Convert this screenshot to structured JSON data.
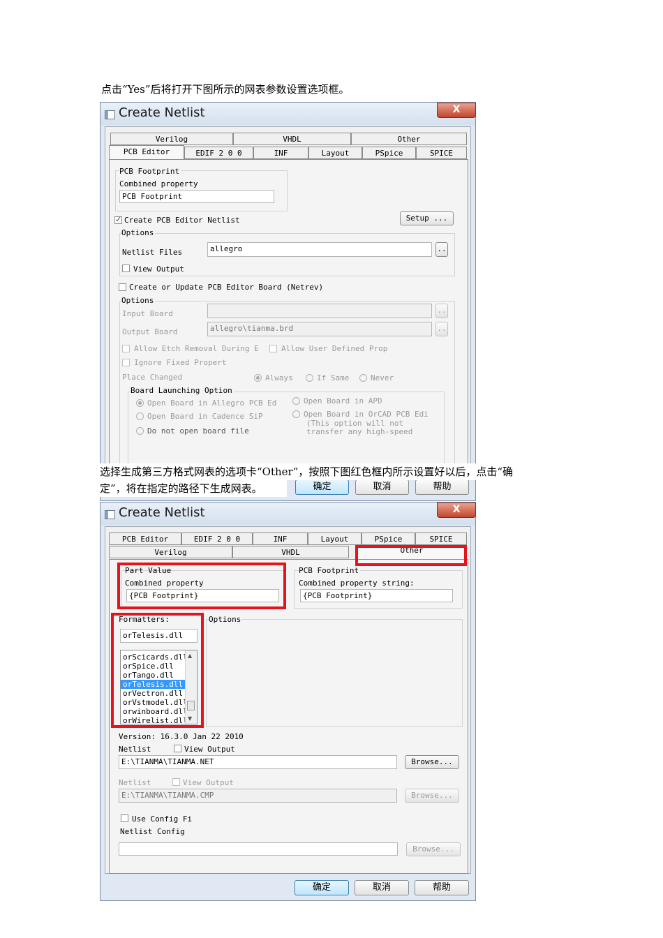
{
  "text": {
    "para1": "点击“Yes”后将打开下图所示的网表参数设置选项框。",
    "para2_line1": "选择生成第三方格式网表的选项卡“Other”，按照下图红色框内所示设置好以后，点击“确",
    "para2_line2": "定”，将在指定的路径下生成网表。"
  },
  "dialog1": {
    "title": "Create Netlist",
    "close": "X",
    "tabs_row1": [
      "Verilog",
      "VHDL",
      "Other"
    ],
    "tabs_row2": [
      "PCB Editor",
      "EDIF 2 0 0",
      "INF",
      "Layout",
      "PSpice",
      "SPICE"
    ],
    "active_tab": "PCB Editor",
    "pcb_footprint": {
      "title": "PCB Footprint",
      "label": "Combined property",
      "value": "PCB Footprint"
    },
    "create_netlist": {
      "label": "Create PCB Editor Netlist",
      "checked": true
    },
    "setup_button": "Setup ...",
    "options1": {
      "title": "Options",
      "netlist_files_label": "Netlist Files",
      "netlist_files_value": "allegro",
      "browse": "..",
      "view_output": "View Output"
    },
    "create_board": {
      "label": "Create or Update PCB Editor Board (Netrev)",
      "checked": false
    },
    "options2": {
      "title": "Options",
      "input_board_label": "Input Board",
      "input_board_value": "",
      "output_board_label": "Output Board",
      "output_board_value": "allegro\\tianma.brd",
      "browse": "..",
      "allow_etch": "Allow Etch Removal During E",
      "allow_user": "Allow User Defined Prop",
      "ignore_fixed": "Ignore Fixed Propert",
      "place_changed": "Place Changed",
      "radio_always": "Always",
      "radio_if_same": "If Same",
      "radio_never": "Never"
    },
    "board_launching": {
      "title": "Board Launching Option",
      "open_allegro": "Open Board in Allegro PCB Ed",
      "open_apd": "Open Board in APD",
      "open_cadence": "Open Board in Cadence SiP",
      "open_orcad": "Open Board in OrCAD PCB Edi",
      "orcad_note1": "(This option will not",
      "orcad_note2": "transfer any high-speed",
      "do_not_open": "Do not open board file"
    },
    "buttons": {
      "ok": "确定",
      "cancel": "取消",
      "help": "帮助"
    }
  },
  "dialog2": {
    "title": "Create Netlist",
    "close": "X",
    "tabs_row1": [
      "PCB Editor",
      "EDIF 2 0 0",
      "INF",
      "Layout",
      "PSpice",
      "SPICE"
    ],
    "tabs_row2": [
      "Verilog",
      "VHDL",
      "Other"
    ],
    "active_tab": "Other",
    "part_value": {
      "title": "Part Value",
      "label": "Combined property",
      "value": "{PCB Footprint}"
    },
    "pcb_footprint": {
      "title": "PCB Footprint",
      "label": "Combined property string:",
      "value": "{PCB Footprint}"
    },
    "formatters": {
      "title": "Formatters:",
      "value": "orTelesis.dll",
      "items": [
        "orScicards.dll",
        "orSpice.dll",
        "orTango.dll",
        "orTelesis.dll",
        "orVectron.dll",
        "orVstmodel.dll",
        "orwinboard.dll",
        "orWirelist.dll"
      ],
      "selected": "orTelesis.dll"
    },
    "options_title": "Options",
    "version": "Version: 16.3.0  Jan 22 2010",
    "netlist1": {
      "label": "Netlist",
      "view_output": "View Output",
      "path": "E:\\TIANMA\\TIANMA.NET",
      "browse": "Browse..."
    },
    "netlist2": {
      "label": "Netlist",
      "view_output": "View Output",
      "path": "E:\\TIANMA\\TIANMA.CMP",
      "browse": "Browse..."
    },
    "use_config": "Use Config Fi",
    "netlist_config": "Netlist Config",
    "config_path": "",
    "browse3": "Browse...",
    "buttons": {
      "ok": "确定",
      "cancel": "取消",
      "help": "帮助"
    }
  },
  "colors": {
    "highlight_red": "#e3141b",
    "selection_blue": "#3399ff"
  }
}
